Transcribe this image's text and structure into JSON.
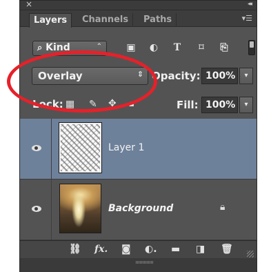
{
  "window": {
    "close_glyph": "×",
    "collapse_glyph": "◂◂"
  },
  "tabs": [
    {
      "label": "Layers",
      "active": true
    },
    {
      "label": "Channels",
      "active": false
    },
    {
      "label": "Paths",
      "active": false
    }
  ],
  "tab_menu_glyph": "▾☰",
  "filter": {
    "kind_label": "Kind",
    "kind_icon": "search-icon",
    "icons": [
      "image-filter-icon",
      "adjustment-filter-icon",
      "type-filter-icon",
      "shape-filter-icon",
      "smart-object-filter-icon"
    ]
  },
  "blend": {
    "mode": "Overlay",
    "opacity_label": "Opacity:",
    "opacity_value": "100%"
  },
  "lock": {
    "label": "Lock:",
    "fill_label": "Fill:",
    "fill_value": "100%"
  },
  "layers": [
    {
      "name": "Layer 1",
      "visible": true,
      "selected": true,
      "locked": false
    },
    {
      "name": "Background",
      "visible": true,
      "selected": false,
      "locked": true
    }
  ],
  "bottom_icons": [
    "link-icon",
    "fx-icon",
    "mask-icon",
    "adjustment-icon",
    "folder-icon",
    "new-layer-icon",
    "trash-icon"
  ],
  "bottom_fx_label": "fx",
  "colors": {
    "panel": "#535353",
    "selected_layer": "#6e819a",
    "annotation": "#e6212a"
  }
}
